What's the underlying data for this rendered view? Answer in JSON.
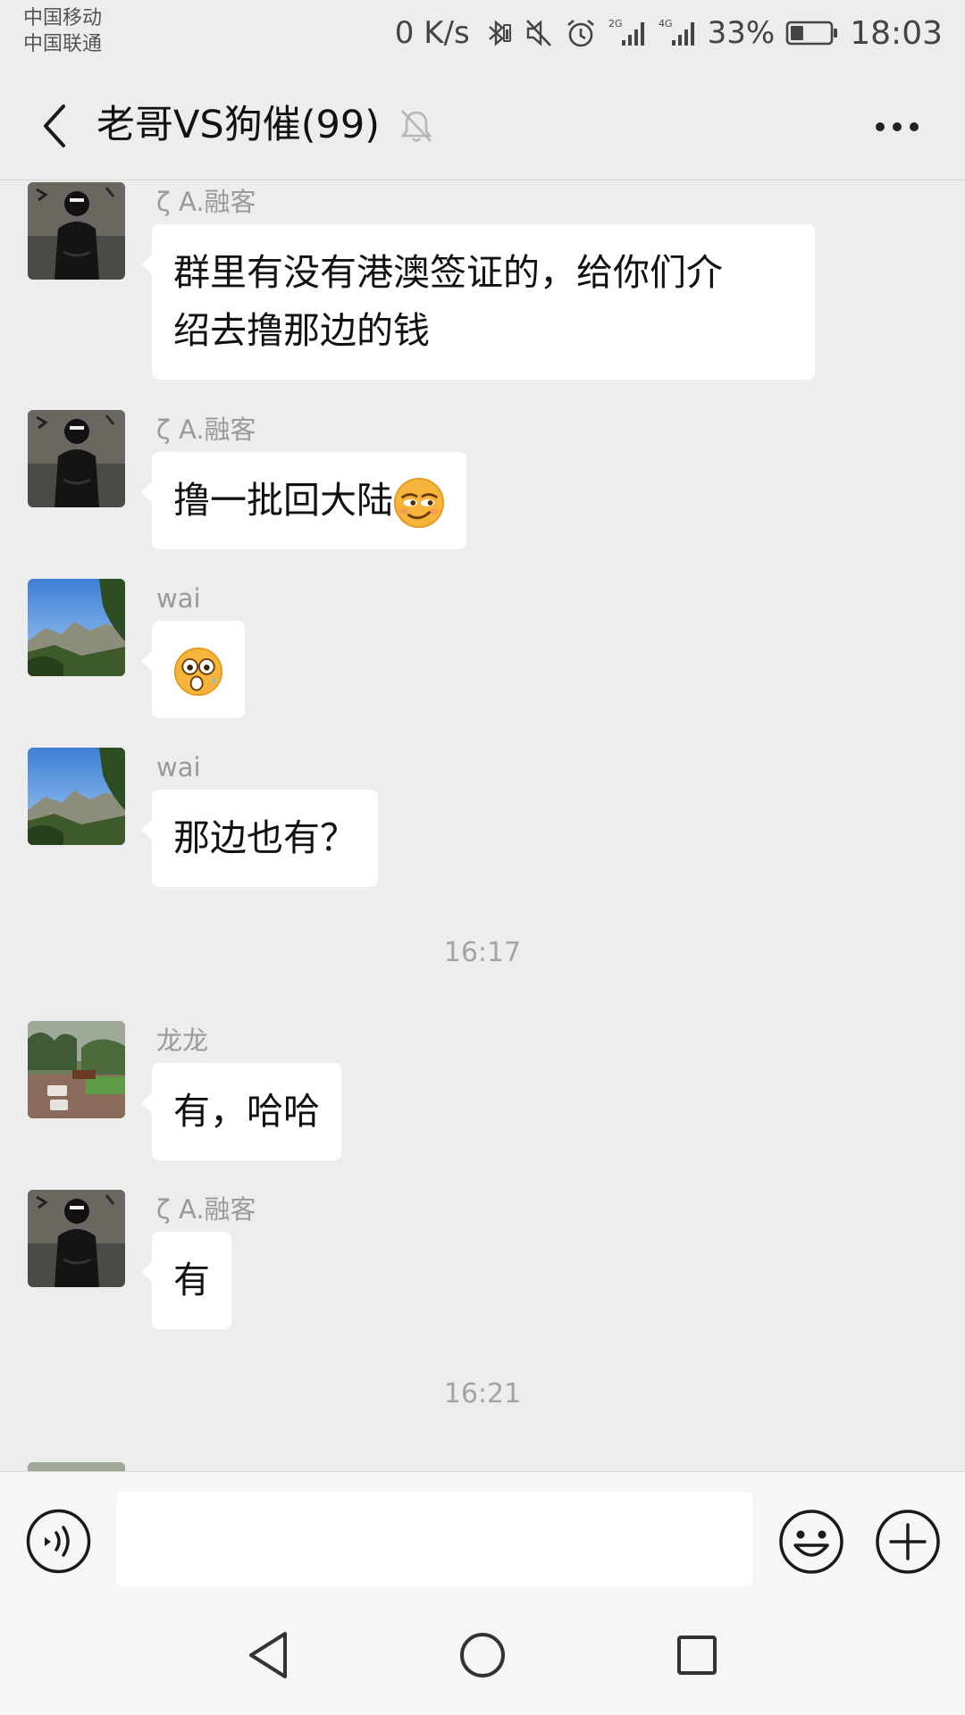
{
  "status_bar": {
    "carrier_1": "中国移动",
    "carrier_2": "中国联通",
    "net_speed": "0 K/s",
    "network_1": "2G",
    "network_2": "4G",
    "battery": "33%",
    "battery_level": 0.33,
    "time": "18:03"
  },
  "header": {
    "title": "老哥VS狗催(99)",
    "back_icon": "chevron-left-icon",
    "mute_icon": "bell-muted-icon",
    "more_icon": "more-dots-icon"
  },
  "messages": [
    {
      "sender": "ζ A.融客",
      "avatar": "avatar-black-figure",
      "lines": [
        "群里有没有港澳签证的，给你们介",
        "绍去撸那边的钱"
      ]
    },
    {
      "sender": "ζ A.融客",
      "avatar": "avatar-black-figure",
      "text": "撸一批回大陆",
      "emoji": "smirk-emoji"
    },
    {
      "sender": "wai",
      "avatar": "avatar-mountain",
      "emoji": "surprised-emoji"
    },
    {
      "sender": "wai",
      "avatar": "avatar-mountain",
      "text": "那边也有？"
    },
    {
      "sender": "龙龙",
      "avatar": "avatar-park",
      "text": "有，哈哈"
    },
    {
      "sender": "ζ A.融客",
      "avatar": "avatar-black-figure",
      "text": "有"
    }
  ],
  "timestamps": [
    "16:17",
    "16:21"
  ],
  "input_bar": {
    "voice_icon": "voice-icon",
    "placeholder": "",
    "emoji_icon": "smiley-icon",
    "plus_icon": "plus-circle-icon"
  },
  "nav_bar": {
    "back_icon": "triangle-back-icon",
    "home_icon": "circle-home-icon",
    "recents_icon": "square-recents-icon"
  },
  "colors": {
    "background": "#ededed",
    "bubble": "#ffffff",
    "sender_name": "#9a9a9a",
    "timestamp": "#a4a4a4",
    "bar": "#f6f6f6"
  }
}
